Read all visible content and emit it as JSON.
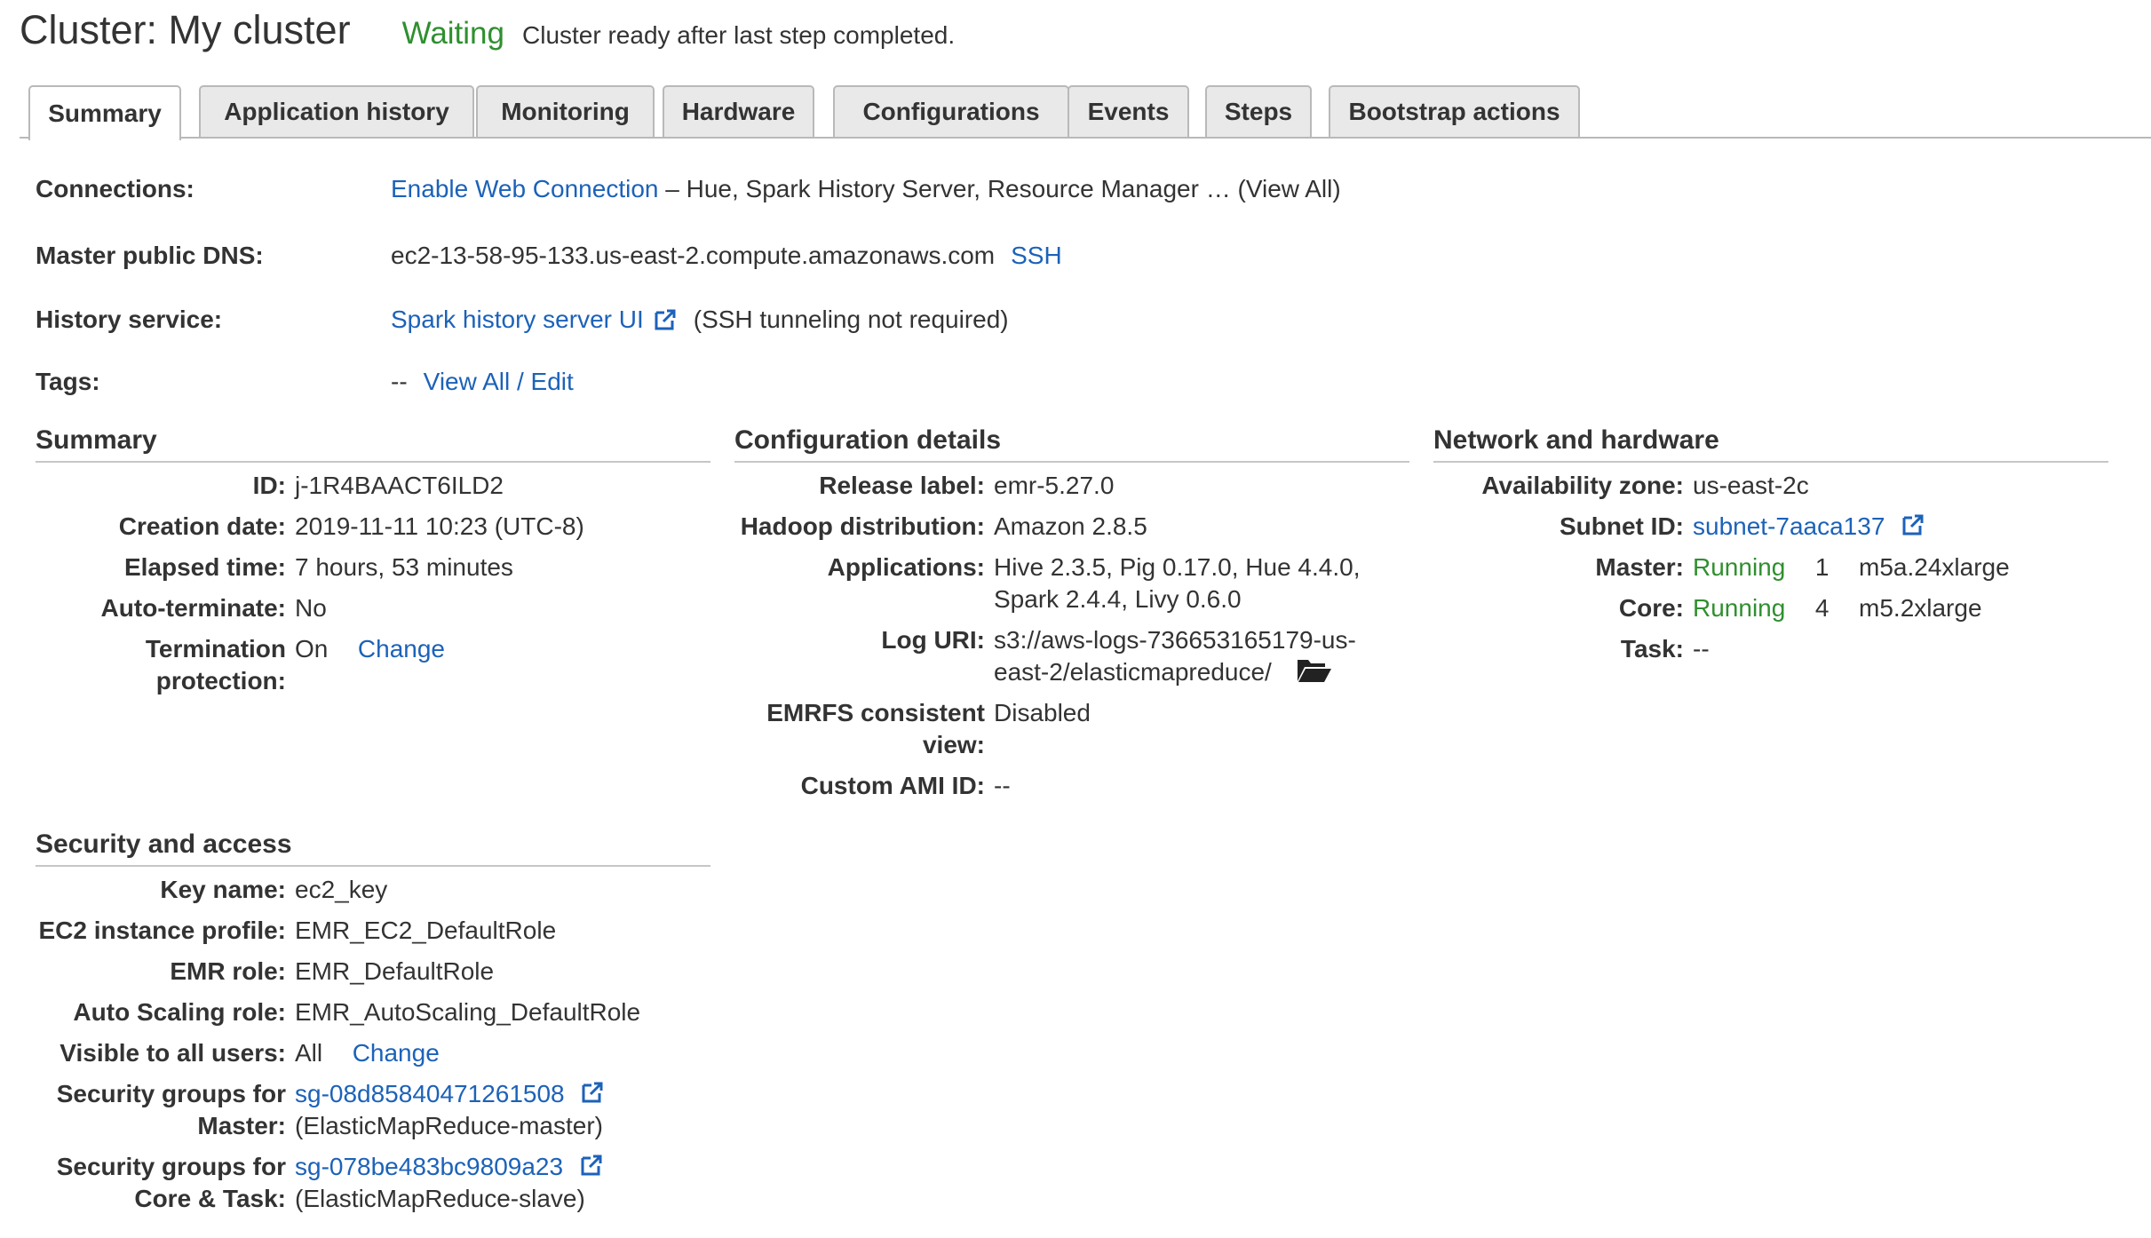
{
  "header": {
    "title": "Cluster: My cluster",
    "state": "Waiting",
    "state_message": "Cluster ready after last step completed."
  },
  "tabs": [
    {
      "label": "Summary",
      "active": true
    },
    {
      "label": "Application history"
    },
    {
      "label": "Monitoring"
    },
    {
      "label": "Hardware"
    },
    {
      "label": "Configurations"
    },
    {
      "label": "Events"
    },
    {
      "label": "Steps"
    },
    {
      "label": "Bootstrap actions"
    }
  ],
  "top": {
    "connections": {
      "label": "Connections:",
      "link": "Enable Web Connection",
      "text": " – Hue, Spark History Server, Resource Manager … (View All)"
    },
    "dns": {
      "label": "Master public DNS:",
      "value": "ec2-13-58-95-133.us-east-2.compute.amazonaws.com",
      "link": "SSH"
    },
    "history": {
      "label": "History service:",
      "link": "Spark history server UI",
      "note": "(SSH tunneling not required)"
    },
    "tags": {
      "label": "Tags:",
      "value": "--",
      "link": "View All / Edit"
    }
  },
  "summary": {
    "heading": "Summary",
    "id_label": "ID:",
    "id_value": "j-1R4BAACT6ILD2",
    "creation_label": "Creation date:",
    "creation_value": "2019-11-11 10:23 (UTC-8)",
    "elapsed_label": "Elapsed time:",
    "elapsed_value": "7 hours, 53 minutes",
    "autoterm_label": "Auto-terminate:",
    "autoterm_value": "No",
    "termprot_label_1": "Termination",
    "termprot_label_2": "protection:",
    "termprot_value": "On",
    "termprot_link": "Change"
  },
  "config": {
    "heading": "Configuration details",
    "release_label": "Release label:",
    "release_value": "emr-5.27.0",
    "hadoop_label": "Hadoop distribution:",
    "hadoop_value": "Amazon 2.8.5",
    "apps_label": "Applications:",
    "apps_value_1": "Hive 2.3.5, Pig 0.17.0, Hue 4.4.0,",
    "apps_value_2": "Spark 2.4.4, Livy 0.6.0",
    "log_label": "Log URI:",
    "log_value_1": "s3://aws-logs-736653165179-us-",
    "log_value_2": "east-2/elasticmapreduce/",
    "emrfs_label_1": "EMRFS consistent",
    "emrfs_label_2": "view:",
    "emrfs_value": "Disabled",
    "ami_label": "Custom AMI ID:",
    "ami_value": "--"
  },
  "network": {
    "heading": "Network and hardware",
    "az_label": "Availability zone:",
    "az_value": "us-east-2c",
    "subnet_label": "Subnet ID:",
    "subnet_value": "subnet-7aaca137",
    "master_label": "Master:",
    "master_state": "Running",
    "master_count": "1",
    "master_type": "m5a.24xlarge",
    "core_label": "Core:",
    "core_state": "Running",
    "core_count": "4",
    "core_type": "m5.2xlarge",
    "task_label": "Task:",
    "task_value": "--"
  },
  "security": {
    "heading": "Security and access",
    "key_label": "Key name:",
    "key_value": "ec2_key",
    "profile_label": "EC2 instance profile:",
    "profile_value": "EMR_EC2_DefaultRole",
    "emr_role_label": "EMR role:",
    "emr_role_value": "EMR_DefaultRole",
    "as_role_label": "Auto Scaling role:",
    "as_role_value": "EMR_AutoScaling_DefaultRole",
    "visible_label": "Visible to all users:",
    "visible_value": "All",
    "visible_link": "Change",
    "sg_master_label_1": "Security groups for",
    "sg_master_label_2": "Master:",
    "sg_master_link": "sg-08d85840471261508",
    "sg_master_name": "(ElasticMapReduce-master)",
    "sg_core_label_1": "Security groups for",
    "sg_core_label_2": "Core & Task:",
    "sg_core_link": "sg-078be483bc9809a23",
    "sg_core_name": "(ElasticMapReduce-slave)"
  },
  "colors": {
    "link": "#1c62b9",
    "running": "#2f8f2f",
    "tab_bg": "#e9e9e9",
    "border": "#b9b9b9"
  },
  "icons": [
    "external-link-icon",
    "folder-open-icon"
  ]
}
